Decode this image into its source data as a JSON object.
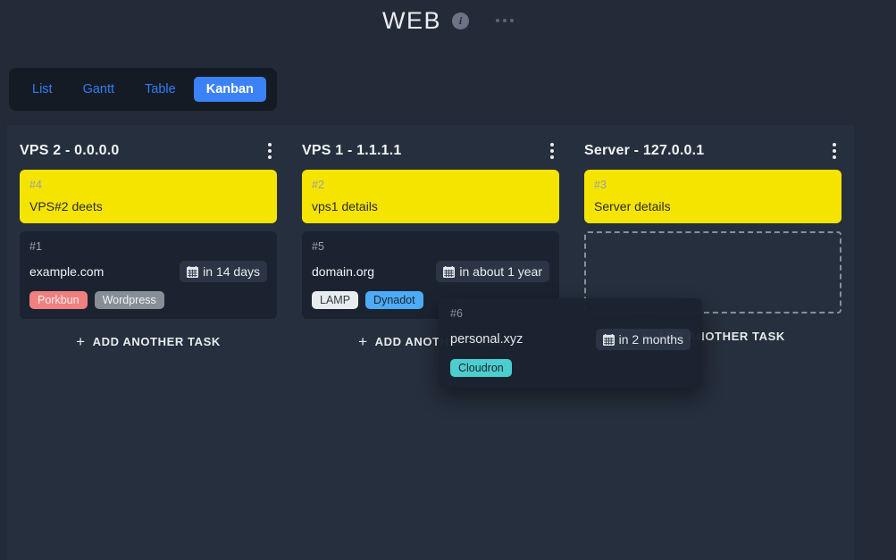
{
  "header": {
    "title": "WEB",
    "info_icon": "info-circle-icon",
    "more_icon": "ellipsis-horizontal-icon"
  },
  "tabs": [
    {
      "label": "List",
      "active": false
    },
    {
      "label": "Gantt",
      "active": false
    },
    {
      "label": "Table",
      "active": false
    },
    {
      "label": "Kanban",
      "active": true
    }
  ],
  "add_task_label": "ADD ANOTHER TASK",
  "plus_glyph": "+",
  "columns": [
    {
      "title": "VPS 2 - 0.0.0.0",
      "menu_icon": "more-vertical-icon",
      "cards": [
        {
          "id": "#4",
          "title": "VPS#2 deets",
          "style": "yellow",
          "date": "",
          "tags": []
        },
        {
          "id": "#1",
          "title": "example.com",
          "style": "dark",
          "date": "in 14 days",
          "tags": [
            {
              "label": "Porkbun",
              "bg": "#f08080",
              "fg": "#f8eded"
            },
            {
              "label": "Wordpress",
              "bg": "#868e96",
              "fg": "#f1f3f5"
            }
          ]
        }
      ],
      "placeholder": false
    },
    {
      "title": "VPS 1 - 1.1.1.1",
      "menu_icon": "more-vertical-icon",
      "cards": [
        {
          "id": "#2",
          "title": "vps1 details",
          "style": "yellow",
          "date": "",
          "tags": []
        },
        {
          "id": "#5",
          "title": "domain.org",
          "style": "dark",
          "date": "in about 1 year",
          "tags": [
            {
              "label": "LAMP",
              "bg": "#e9ecef",
              "fg": "#343a40"
            },
            {
              "label": "Dynadot",
              "bg": "#4dabf7",
              "fg": "#1b2331"
            }
          ]
        }
      ],
      "placeholder": false
    },
    {
      "title": "Server - 127.0.0.1",
      "menu_icon": "more-vertical-icon",
      "cards": [
        {
          "id": "#3",
          "title": "Server details",
          "style": "yellow",
          "date": "",
          "tags": []
        }
      ],
      "placeholder": true
    }
  ],
  "dragging_card": {
    "id": "#6",
    "title": "personal.xyz",
    "date": "in 2 months",
    "tags": [
      {
        "label": "Cloudron",
        "bg": "#4ed4d4",
        "fg": "#1b2331"
      }
    ]
  },
  "colors": {
    "page_bg": "#232b38",
    "column_bg": "#262f3d",
    "card_dark": "#1b2331",
    "card_yellow": "#f5e400",
    "accent_blue": "#3b82f6",
    "link_blue": "#2f7df4",
    "tabbar_bg": "#151b25"
  }
}
